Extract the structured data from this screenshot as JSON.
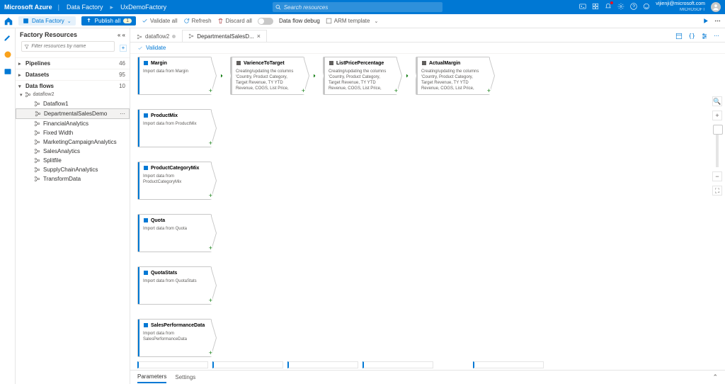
{
  "header": {
    "brand": "Microsoft Azure",
    "crumb1": "Data Factory",
    "crumb2": "UxDemoFactory",
    "search_placeholder": "Search resources",
    "user_email": "vijienji@microsoft.com",
    "user_org": "MICROSOFT"
  },
  "toolbar": {
    "factory_label": "Data Factory",
    "publish_label": "Publish all",
    "publish_count": "1",
    "validate_label": "Validate all",
    "refresh_label": "Refresh",
    "discard_label": "Discard all",
    "debug_label": "Data flow debug",
    "arm_label": "ARM template"
  },
  "sidebar": {
    "title": "Factory Resources",
    "filter_placeholder": "Filter resources by name",
    "sections": [
      {
        "label": "Pipelines",
        "count": "46"
      },
      {
        "label": "Datasets",
        "count": "95"
      },
      {
        "label": "Data flows",
        "count": "10"
      }
    ],
    "flows": [
      "dataflow2",
      "Dataflow1",
      "DepartmentalSalesDemo",
      "FinancialAnalytics",
      "Fixed Width",
      "MarketingCampaignAnalytics",
      "SalesAnalytics",
      "Splitfile",
      "SupplyChainAnalytics",
      "TransformData"
    ],
    "selected": "DepartmentalSalesDemo"
  },
  "tabs": [
    {
      "label": "dataflow2",
      "active": false
    },
    {
      "label": "DepartmentalSalesD...",
      "active": true
    }
  ],
  "validate": "Validate",
  "canvas": {
    "row1": [
      {
        "title": "Margin",
        "desc": "Import data from Margin",
        "type": "source"
      },
      {
        "title": "VarienceToTarget",
        "desc": "Creating/updating the columns 'Country, Product Category, Target Revenue, TY YTD Revenue, COGS, List Price,",
        "type": "step"
      },
      {
        "title": "ListPricePercentage",
        "desc": "Creating/updating the columns 'Country, Product Category, Target Revenue, TY YTD Revenue, COGS, List Price,",
        "type": "step"
      },
      {
        "title": "ActualMargin",
        "desc": "Creating/updating the columns 'Country, Product Category, Target Revenue, TY YTD Revenue, COGS, List Price,",
        "type": "step"
      }
    ],
    "others": [
      {
        "title": "ProductMix",
        "desc": "Import data from ProductMix"
      },
      {
        "title": "ProductCategoryMix",
        "desc": "Import data from ProductCategoryMix"
      },
      {
        "title": "Quota",
        "desc": "Import data from Quota"
      },
      {
        "title": "QuotaStats",
        "desc": "Import data from QuotaStats"
      },
      {
        "title": "SalesPerformanceData",
        "desc": "Import data from SalesPerformanceData"
      }
    ]
  },
  "bottom": {
    "tab1": "Parameters",
    "tab2": "Settings"
  }
}
